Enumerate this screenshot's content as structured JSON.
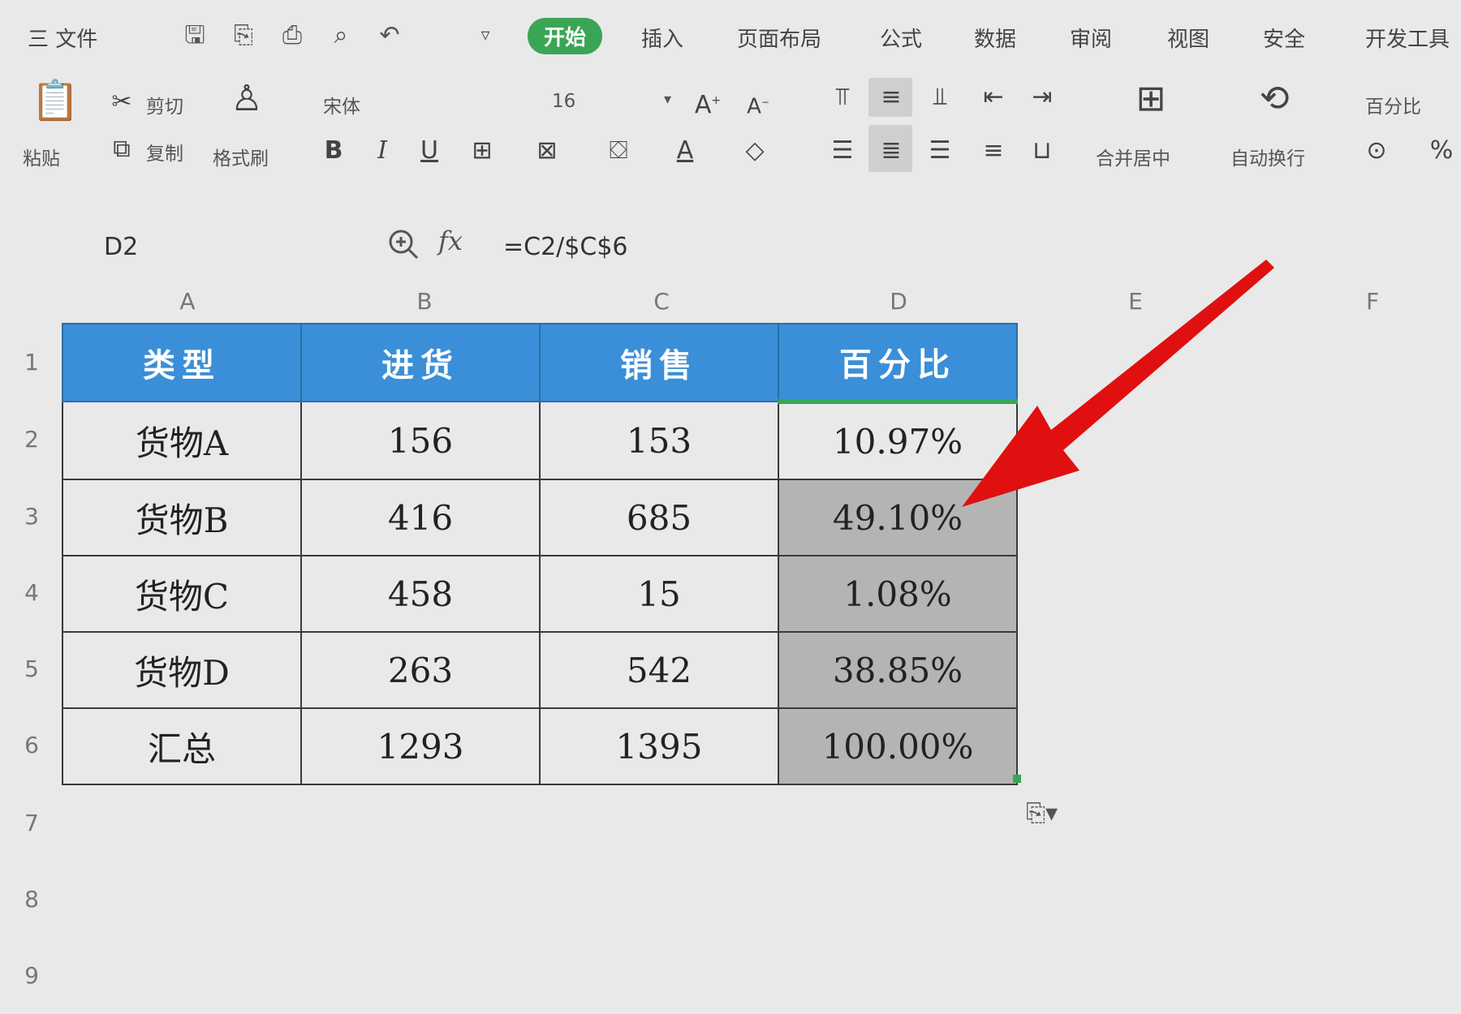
{
  "menu": {
    "file": "三 文件",
    "items": [
      "开始",
      "插入",
      "页面布局",
      "公式",
      "数据",
      "审阅",
      "视图",
      "安全",
      "开发工具"
    ],
    "active_index": 0
  },
  "ribbon": {
    "paste": "粘贴",
    "cut": "剪切",
    "copy": "复制",
    "format_painter": "格式刷",
    "font_name": "宋体",
    "font_size": "16",
    "merge_center": "合并居中",
    "wrap_text": "自动换行",
    "number_format": "百分比",
    "percent_symbol": "%"
  },
  "formula_bar": {
    "cell_ref": "D2",
    "fx": "fx",
    "formula": "=C2/$C$6"
  },
  "sheet": {
    "columns": [
      "A",
      "B",
      "C",
      "D",
      "E",
      "F"
    ],
    "rows": [
      "1",
      "2",
      "3",
      "4",
      "5",
      "6",
      "7",
      "8",
      "9"
    ],
    "header": [
      "类型",
      "进货",
      "销售",
      "百分比"
    ],
    "data": [
      [
        "货物A",
        "156",
        "153",
        "10.97%"
      ],
      [
        "货物B",
        "416",
        "685",
        "49.10%"
      ],
      [
        "货物C",
        "458",
        "15",
        "1.08%"
      ],
      [
        "货物D",
        "263",
        "542",
        "38.85%"
      ],
      [
        "汇总",
        "1293",
        "1395",
        "100.00%"
      ]
    ]
  },
  "colors": {
    "header_fill": "#3a8fd8",
    "active_tab": "#3aa655",
    "selection_fill": "#b4b4b4",
    "arrow": "#e01010"
  }
}
